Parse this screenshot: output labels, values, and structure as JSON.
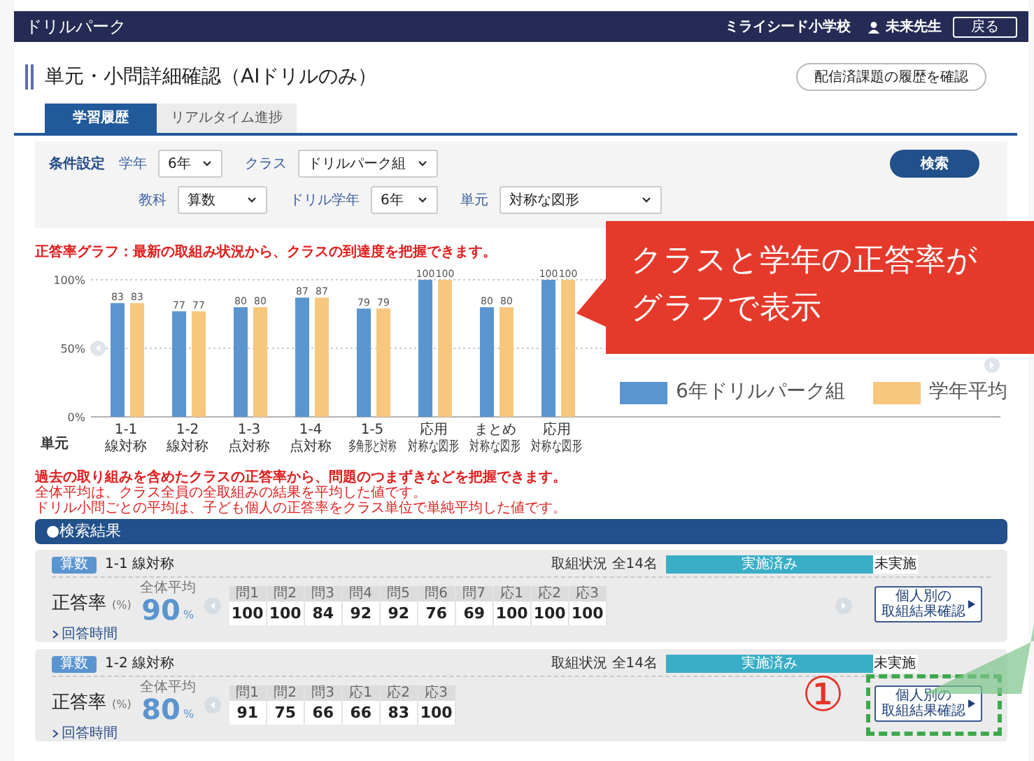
{
  "header": {
    "app_name": "ドリルパーク",
    "school": "ミライシード小学校",
    "user": "未来先生",
    "back_button": "戻る"
  },
  "page": {
    "title": "単元・小問詳細確認（AIドリルのみ）",
    "history_button": "配信済課題の履歴を確認"
  },
  "tabs": [
    {
      "label": "学習履歴",
      "selected": true
    },
    {
      "label": "リアルタイム進捗",
      "selected": false
    }
  ],
  "filters": {
    "title": "条件設定",
    "search_button": "検索",
    "rows": [
      [
        {
          "label": "学年",
          "value": "6年"
        },
        {
          "label": "クラス",
          "value": "ドリルパーク組"
        }
      ],
      [
        {
          "label": "教科",
          "value": "算数"
        },
        {
          "label": "ドリル学年",
          "value": "6年"
        },
        {
          "label": "単元",
          "value": "対称な図形"
        }
      ]
    ]
  },
  "chart_data": {
    "type": "bar",
    "title": "正答率グラフ：最新の取組み状況から、クラスの到達度を把握できます。",
    "xlabel": "単元",
    "categories": [
      "線対称",
      "線対称",
      "点対称",
      "点対称",
      "多角形と対称",
      "対称な図形",
      "対称な図形",
      "対称な図形"
    ],
    "series": [
      {
        "name": "6年ドリルパーク組",
        "color": "#5b95d0",
        "values": [
          83,
          77,
          80,
          87,
          79,
          100,
          80,
          100
        ]
      },
      {
        "name": "学年平均",
        "color": "#f7c77e",
        "values": [
          83,
          77,
          80,
          87,
          79,
          100,
          80,
          100
        ]
      }
    ],
    "legend": true,
    "ylim": [
      0,
      100
    ],
    "yticks": [
      {
        "value": 0,
        "label": "0%"
      },
      {
        "value": 50,
        "label": "50%"
      },
      {
        "value": 100,
        "label": "100%"
      }
    ],
    "data_labels": true
  },
  "chart_category_groups": [
    "1-1",
    "1-2",
    "1-3",
    "1-4",
    "1-5",
    "応用",
    "まとめ",
    "応用"
  ],
  "notes": [
    {
      "text": "過去の取り組みを含めたクラスの正答率から、問題のつまずきなどを把握できます。",
      "bold": true
    },
    {
      "text": "全体平均は、クラス全員の全取組みの結果を平均した値です。",
      "bold": false
    },
    {
      "text": "ドリル小問ごとの平均は、子ども個人の正答率をクラス単位で単純平均した値です。",
      "bold": false
    }
  ],
  "results": {
    "title": "●検索結果",
    "rows": [
      {
        "subject": "算数",
        "unit": "1-1 線対称",
        "status_label": "取組状況 全14名",
        "done_label": "実施済み",
        "not_done_label": "未実施",
        "level": 0.83,
        "score_label": "正答率",
        "score_unit": "(%)",
        "average_label": "全体平均",
        "average": "90",
        "percent": "%",
        "questions": [
          {
            "label": "問1",
            "value": "100"
          },
          {
            "label": "問2",
            "value": "100"
          },
          {
            "label": "問3",
            "value": "84"
          },
          {
            "label": "問4",
            "value": "92"
          },
          {
            "label": "問5",
            "value": "92"
          },
          {
            "label": "問6",
            "value": "76"
          },
          {
            "label": "問7",
            "value": "69"
          },
          {
            "label": "応1",
            "value": "100"
          },
          {
            "label": "応2",
            "value": "100"
          },
          {
            "label": "応3",
            "value": "100"
          }
        ],
        "show_next": true,
        "button": [
          "個人別の",
          "取組結果確認"
        ],
        "link": "回答時間",
        "highlighted": false
      },
      {
        "subject": "算数",
        "unit": "1-2 線対称",
        "status_label": "取組状況 全14名",
        "done_label": "実施済み",
        "not_done_label": "未実施",
        "level": 0.82,
        "score_label": "正答率",
        "score_unit": "(%)",
        "average_label": "全体平均",
        "average": "80",
        "percent": "%",
        "questions": [
          {
            "label": "問1",
            "value": "91"
          },
          {
            "label": "問2",
            "value": "75"
          },
          {
            "label": "問3",
            "value": "66"
          },
          {
            "label": "応1",
            "value": "66"
          },
          {
            "label": "応2",
            "value": "83"
          },
          {
            "label": "応3",
            "value": "100"
          }
        ],
        "show_next": false,
        "button": [
          "個人別の",
          "取組結果確認"
        ],
        "link": "回答時間",
        "highlighted": true
      }
    ]
  },
  "annotations": {
    "callout": [
      "クラスと学年の正答率が",
      "グラフで表示"
    ],
    "marker": "①"
  }
}
